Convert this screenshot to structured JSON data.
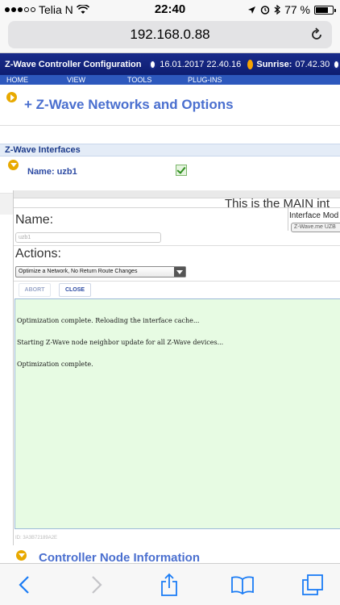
{
  "status_bar": {
    "carrier": "Telia N",
    "time": "22:40",
    "battery": "77 %",
    "battery_level": 0.77
  },
  "browser": {
    "url": "192.168.0.88"
  },
  "header": {
    "title": "Z-Wave Controller Configuration",
    "datetime": "16.01.2017 22.40.16",
    "sunrise_label": "Sunrise:",
    "sunrise_time": "07.42.30"
  },
  "menu": [
    "HOME",
    "VIEW",
    "TOOLS",
    "PLUG-INS"
  ],
  "networks_section": {
    "title": "+ Z-Wave Networks and Options"
  },
  "interfaces": {
    "header": "Z-Wave Interfaces",
    "name_label": "Name: uzb1",
    "enabled": true
  },
  "interface_panel": {
    "main_text": "This is the MAIN int",
    "name_label": "Name:",
    "name_value": "uzb1",
    "mode_label": "Interface Mod",
    "mode_value": "Z-Wave.me UZB",
    "actions_label": "Actions:",
    "action_selected": "Optimize a Network, No Return Route Changes",
    "abort_label": "ABORT",
    "close_label": "CLOSE",
    "console_lines": [
      "Optimization complete. Reloading the interface cache...",
      "Starting Z-Wave node neighbor update for all Z-Wave devices...",
      "Optimization complete."
    ],
    "id_text": "ID: 3A3B72189A2E"
  },
  "controller_section": {
    "title": "Controller Node Information"
  },
  "toolbar_icons": [
    "back-icon",
    "forward-icon",
    "share-icon",
    "bookmarks-icon",
    "tabs-icon"
  ]
}
